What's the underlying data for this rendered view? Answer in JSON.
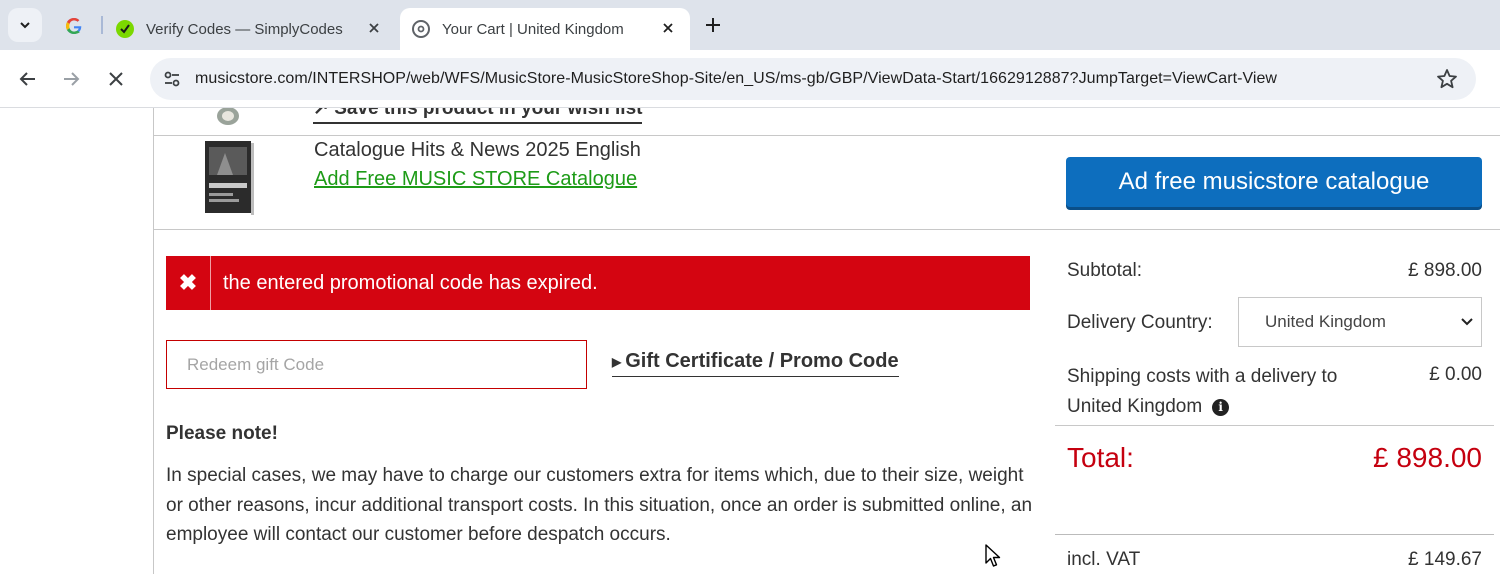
{
  "browser": {
    "tabs": [
      {
        "title": "Verify Codes — SimplyCodes",
        "active": false
      },
      {
        "title": "Your Cart | United Kingdom",
        "active": true
      }
    ],
    "url": "musicstore.com/INTERSHOP/web/WFS/MusicStore-MusicStoreShop-Site/en_US/ms-gb/GBP/ViewData-Start/1662912887?JumpTarget=ViewCart-View"
  },
  "cart": {
    "wishlist_link": "↗ Save this product in your wish list",
    "catalogue": {
      "title": "Catalogue Hits & News 2025 English",
      "link": "Add Free MUSIC STORE Catalogue",
      "button": "Ad free musicstore catalogue"
    },
    "error_message": "the entered promotional code has expired.",
    "gift_code": {
      "placeholder": "Redeem gift Code",
      "value": "",
      "toggle_label": "Gift Certificate / Promo Code"
    },
    "note": {
      "title": "Please note!",
      "text": "In special cases, we may have to charge our customers extra for items which, due to their size, weight or other reasons, incur additional transport costs. In this situation, once an order is submitted online, an employee will contact our customer before despatch occurs."
    }
  },
  "summary": {
    "subtotal_label": "Subtotal:",
    "subtotal_value": "£ 898.00",
    "delivery_country_label": "Delivery Country:",
    "delivery_country_value": "United Kingdom",
    "shipping_label": "Shipping costs with a delivery to United Kingdom",
    "shipping_value": "£ 0.00",
    "total_label": "Total:",
    "total_value": "£ 898.00",
    "vat_label": "incl. VAT",
    "vat_value": "£ 149.67"
  },
  "colors": {
    "accent_blue": "#0d6ebe",
    "error_red": "#d40511",
    "total_red": "#c5000f",
    "link_green": "#1d9b17"
  }
}
